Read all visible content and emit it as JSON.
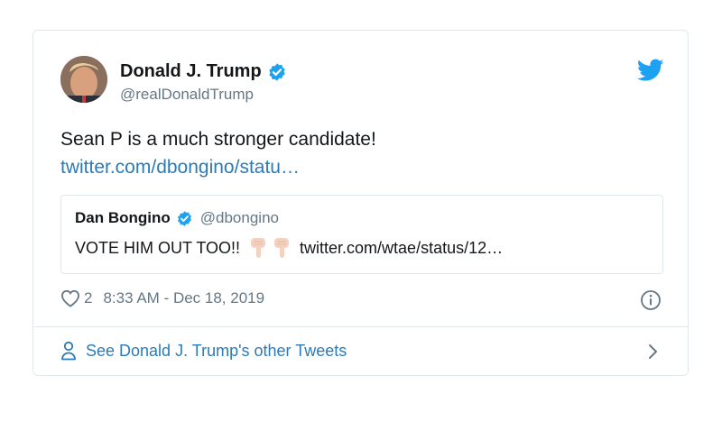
{
  "tweet": {
    "author_name": "Donald J. Trump",
    "author_handle": "@realDonaldTrump",
    "text": "Sean P is a much stronger candidate!",
    "link": "twitter.com/dbongino/statu…",
    "likes": "2",
    "timestamp": "8:33 AM - Dec 18, 2019"
  },
  "quoted": {
    "author_name": "Dan Bongino",
    "author_handle": "@dbongino",
    "text": "VOTE HIM OUT TOO!!",
    "emoji": [
      "backhand-index-pointing-down-icon",
      "backhand-index-pointing-down-icon"
    ],
    "link": "twitter.com/wtae/status/12…"
  },
  "footer": {
    "more_tweets_label": "See Donald J. Trump's other Tweets"
  },
  "colors": {
    "link": "#2b7bb9",
    "verified": "#1da1f2",
    "muted": "#657786",
    "border": "#e1e8ed"
  }
}
